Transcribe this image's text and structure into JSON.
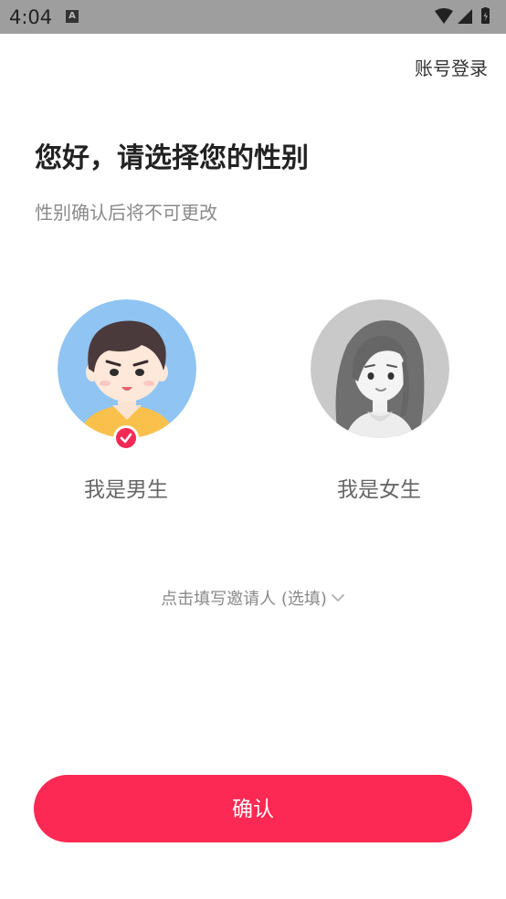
{
  "status_bar": {
    "time": "4:04",
    "notification_icon": "a-icon",
    "icons": [
      "wifi-icon",
      "signal-icon",
      "battery-icon"
    ]
  },
  "header": {
    "account_login": "账号登录"
  },
  "main": {
    "title": "您好，请选择您的性别",
    "subtitle": "性别确认后将不可更改",
    "options": [
      {
        "label": "我是男生",
        "selected": true,
        "avatar": "male-avatar",
        "avatar_bg": "#8fc4f3"
      },
      {
        "label": "我是女生",
        "selected": false,
        "avatar": "female-avatar",
        "avatar_bg": "#c9c9c9"
      }
    ],
    "inviter_text": "点击填写邀请人 (选填)"
  },
  "footer": {
    "confirm_label": "确认"
  },
  "colors": {
    "accent": "#fb2953",
    "status_bar": "#9e9e9e"
  }
}
